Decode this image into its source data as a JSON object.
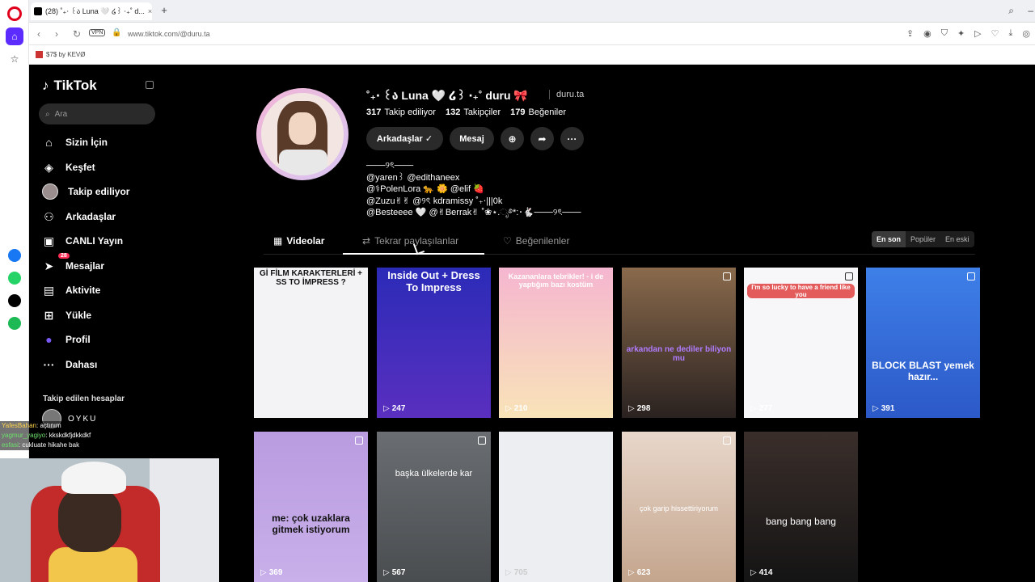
{
  "browser": {
    "tab_title": "(28) ˚₊‧ ꒰ა Luna 🤍 ໒꒱ ‧₊˚ d...",
    "url": "www.tiktok.com/@duru.ta",
    "vpn": "VPN",
    "bookmark": "$7$ by KEVØ"
  },
  "nav": {
    "brand": "TikTok",
    "search_placeholder": "Ara",
    "items": [
      {
        "label": "Sizin İçin"
      },
      {
        "label": "Keşfet"
      },
      {
        "label": "Takip ediliyor"
      },
      {
        "label": "Arkadaşlar"
      },
      {
        "label": "CANLI Yayın"
      },
      {
        "label": "Mesajlar",
        "badge": "28"
      },
      {
        "label": "Aktivite"
      },
      {
        "label": "Yükle"
      },
      {
        "label": "Profil"
      },
      {
        "label": "Dahası"
      }
    ],
    "following_title": "Takip edilen hesaplar",
    "following_account": "OYKU"
  },
  "profile": {
    "nickname": "˚₊‧ ꒰ა Luna 🤍 ໒꒱ ‧₊˚ duru 🎀",
    "username": "duru.ta",
    "following": "317",
    "following_label": "Takip ediliyor",
    "followers": "132",
    "followers_label": "Takipçiler",
    "likes": "179",
    "likes_label": "Beğeniler",
    "btn_friends": "Arkadaşlar ✓",
    "btn_message": "Mesaj",
    "bio": "───୨ৎ───\n@yaren꒱ @edithaneex\n@⚕PolenLora 🐆 🌼 @elif 🍓\n@Zuzu✌✌ @୨ৎ kdramissy ˚₊‧|||0k\n@Besteeee 🤍 @✌Berrak✌ ˚❀⋆.ೃ࿔*:･🐇───୨ৎ───"
  },
  "tabs": {
    "videos": "Videolar",
    "reposts": "Tekrar paylaşılanlar",
    "likes": "Beğenilenler"
  },
  "sort": {
    "latest": "En son",
    "popular": "Popüler",
    "oldest": "En eski"
  },
  "videos": [
    {
      "views": "",
      "caption": "Gİ FİLM KARAKTERLERİ + SS TO İMPRESS ?"
    },
    {
      "views": "247",
      "caption": "Inside Out + Dress To Impress"
    },
    {
      "views": "210",
      "caption": "Kazananlara tebrikler! - i de yaptığım bazı kostüm"
    },
    {
      "views": "298",
      "caption": "arkandan ne dediler biliyon mu"
    },
    {
      "views": "277",
      "caption": "I'm so lucky to have a friend like you"
    },
    {
      "views": "391",
      "caption": "BLOCK BLAST yemek hazır..."
    },
    {
      "views": "369",
      "caption": "me: çok uzaklara gitmek istiyorum"
    },
    {
      "views": "567",
      "caption": "başka ülkelerde kar"
    },
    {
      "views": "705",
      "caption": ""
    },
    {
      "views": "623",
      "caption": "çok garip hissettiriyorum"
    },
    {
      "views": "414",
      "caption": "bang bang bang"
    }
  ],
  "stream_chat": [
    {
      "user": "YafesBahan",
      "text": "açtınım"
    },
    {
      "user": "yagmur_yagiyo",
      "text": "kkskdkfjdkkdkf"
    },
    {
      "user": "esfasi",
      "text": "cukluate hikahe bak"
    }
  ]
}
